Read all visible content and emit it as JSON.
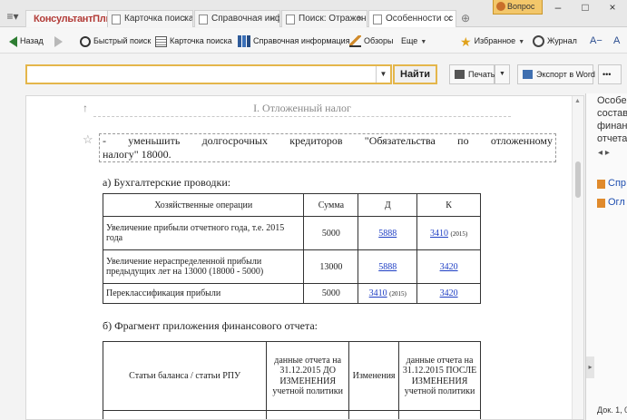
{
  "tabs": {
    "logo": "КонсультантПлюс",
    "items": [
      {
        "label": "Карточка поиска",
        "active": false
      },
      {
        "label": "Справочная инф",
        "active": false
      },
      {
        "label": "Поиск: Отражен",
        "active": false
      },
      {
        "label": "Особенности сс",
        "active": true
      }
    ],
    "ask_button": "Вопрос"
  },
  "toolbar": {
    "back": "Назад",
    "quick_search": "Быстрый поиск",
    "search_card": "Карточка поиска",
    "reference": "Справочная информация",
    "reviews": "Обзоры",
    "more": "Еще",
    "favorites": "Избранное",
    "journal": "Журнал",
    "font_size": "A−"
  },
  "search": {
    "value": "",
    "find_label": "Найти",
    "print_label": "Печать",
    "export_label": "Экспорт в Word",
    "more_label": "•••"
  },
  "document": {
    "section_title": "I. Отложенный налог",
    "paragraph_line1": "- уменьшить долгосрочных кредиторов \"Обязательства по отложенному",
    "paragraph_line2": "налогу\" 18000.",
    "heading_a": "а) Бухгалтерские проводки:",
    "table1": {
      "headers": [
        "Хозяйственные операции",
        "Сумма",
        "Д",
        "К"
      ],
      "rows": [
        {
          "op": "Увеличение прибыли отчетного года, т.е. 2015 года",
          "sum": "5000",
          "d": "5888",
          "d_year": "",
          "k": "3410",
          "k_year": "(2015)"
        },
        {
          "op": "Увеличение нераспределенной прибыли предыдущих лет на 13000 (18000 - 5000)",
          "sum": "13000",
          "d": "5888",
          "d_year": "",
          "k": "3420",
          "k_year": ""
        },
        {
          "op": "Переклассификация прибыли",
          "sum": "5000",
          "d": "3410",
          "d_year": "(2015)",
          "k": "3420",
          "k_year": ""
        }
      ]
    },
    "heading_b": "б) Фрагмент приложения финансового отчета:",
    "table2": {
      "col1": "Статьи баланса / статьи РПУ",
      "col2": "данные отчета на 31.12.2015 ДО ИЗМЕНЕНИЯ учетной политики",
      "col3": "Изменения",
      "col4": "данные отчета на 31.12.2015 ПОСЛЕ ИЗМЕНЕНИЯ учетной политики"
    }
  },
  "right_panel": {
    "text_lines": [
      "Особе",
      "состав",
      "финан",
      "отчета"
    ],
    "links": [
      "Спр",
      "Огл"
    ],
    "footer": "Док. 1, 0"
  }
}
